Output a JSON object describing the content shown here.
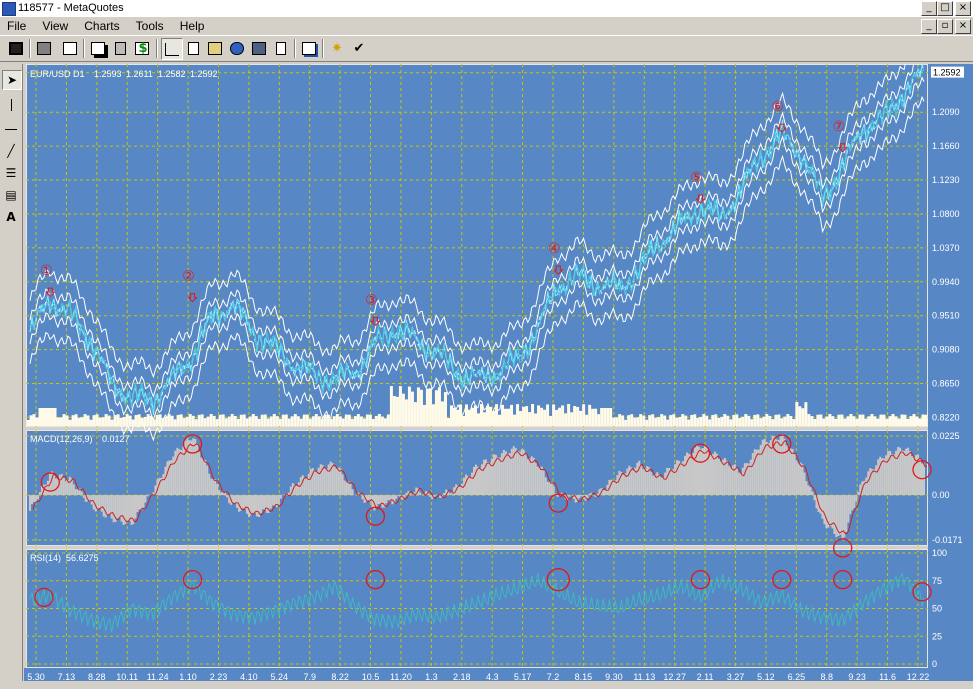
{
  "window": {
    "title": "118577 - MetaQuotes"
  },
  "menu": [
    "File",
    "View",
    "Charts",
    "Tools",
    "Help"
  ],
  "toolbar_icons": [
    "save-icon",
    "print-icon",
    "properties-icon",
    "new-chart-icon",
    "delete-icon",
    "history-icon",
    "dollar-icon",
    "line-chart-icon",
    "blank-page-icon",
    "templates-icon",
    "globe-icon",
    "screenshot-icon",
    "report-icon",
    "windows-icon",
    "expert-icon",
    "check-icon"
  ],
  "drawing_tools": [
    "cursor-icon",
    "vertical-line-icon",
    "horizontal-line-icon",
    "trend-line-icon",
    "fibonacci-icon",
    "channel-icon",
    "text-tool-icon"
  ],
  "colors": {
    "chart_bg": "#5787c5",
    "grid": "#c8c800",
    "band": "#ffffff",
    "price": "#7fe8ff",
    "volume": "#fffbe8",
    "macd_hist": "#c8c8c8",
    "signal": "#cc2222",
    "rsi": "#3fb8c0",
    "marker": "#e01818"
  },
  "chart_data": [
    {
      "type": "line",
      "header": "EUR/USD D1",
      "ohlc": [
        "1.2593",
        "1.2611",
        "1.2582",
        "1.2592"
      ],
      "ylim": [
        0.82,
        1.26
      ],
      "yticks": [
        "1.2590",
        "1.2090",
        "1.1660",
        "1.1230",
        "1.0800",
        "1.0370",
        "0.9940",
        "0.9510",
        "0.9080",
        "0.8650",
        "0.8220"
      ],
      "current_price": "1.2592",
      "x_ticks": [
        "5.30",
        "7.13",
        "8.28",
        "10.11",
        "11.24",
        "1.10",
        "2.23",
        "4.10",
        "5.24",
        "7.9",
        "8.22",
        "10.5",
        "11.20",
        "1.3",
        "2.18",
        "4.3",
        "5.17",
        "7.2",
        "8.15",
        "9.30",
        "11.13",
        "12.27",
        "2.11",
        "3.27",
        "5.12",
        "6.25",
        "8.8",
        "9.23",
        "11.6",
        "12.22"
      ],
      "x_dates_approx": [
        "2000-05-30",
        "2001-12-22"
      ],
      "series": [
        {
          "values": [
            0.93,
            0.972,
            0.952,
            0.92,
            0.865,
            0.848,
            0.844,
            0.87,
            0.9,
            0.95,
            0.965,
            0.93,
            0.91,
            0.89,
            0.875,
            0.87,
            0.88,
            0.915,
            0.935,
            0.92,
            0.905,
            0.88,
            0.87,
            0.88,
            0.895,
            0.935,
            0.99,
            1.0,
            0.99,
            0.985,
            1.01,
            1.045,
            1.065,
            1.09,
            1.075,
            1.11,
            1.155,
            1.18,
            1.155,
            1.1,
            1.14,
            1.19,
            1.2,
            1.235,
            1.2592
          ]
        }
      ],
      "markers": [
        {
          "label": "①",
          "value": 0.972
        },
        {
          "label": "②",
          "value": 0.965
        },
        {
          "label": "③",
          "value": 0.935
        },
        {
          "label": "④",
          "value": 1.0
        },
        {
          "label": "⑤",
          "value": 1.09
        },
        {
          "label": "⑥",
          "value": 1.18
        },
        {
          "label": "⑦",
          "value": 1.155
        }
      ]
    },
    {
      "type": "area",
      "header": "MACD(12,26,9)",
      "value": "0.0127",
      "ylim": [
        -0.0171,
        0.0225
      ],
      "yticks": [
        "0.0225",
        "0.00",
        "-0.0171"
      ],
      "series": [
        {
          "name": "MACD",
          "values": [
            -0.006,
            0.008,
            0.006,
            -0.004,
            -0.009,
            -0.011,
            0.001,
            0.015,
            0.0225,
            0.006,
            -0.004,
            -0.008,
            -0.005,
            0.004,
            0.01,
            0.012,
            0.001,
            -0.005,
            -0.002,
            0.002,
            -0.001,
            0.003,
            0.011,
            0.015,
            0.018,
            0.012,
            0.0,
            -0.002,
            0.001,
            0.008,
            0.012,
            0.007,
            0.013,
            0.019,
            0.014,
            0.009,
            0.02,
            0.0225,
            0.011,
            -0.01,
            -0.0171,
            0.006,
            0.015,
            0.018,
            0.0127
          ]
        }
      ]
    },
    {
      "type": "line",
      "header": "RSI(14)",
      "value": "56.6275",
      "ylim": [
        0,
        100
      ],
      "yticks": [
        "100",
        "75",
        "50",
        "25",
        "0"
      ],
      "series": [
        {
          "name": "RSI",
          "values": [
            58,
            62,
            48,
            40,
            35,
            50,
            45,
            60,
            72,
            55,
            45,
            42,
            48,
            55,
            60,
            70,
            52,
            40,
            38,
            45,
            42,
            48,
            55,
            62,
            68,
            75,
            65,
            55,
            52,
            50,
            58,
            62,
            70,
            60,
            75,
            68,
            55,
            62,
            48,
            42,
            40,
            55,
            68,
            78,
            56.6275
          ]
        }
      ]
    }
  ]
}
